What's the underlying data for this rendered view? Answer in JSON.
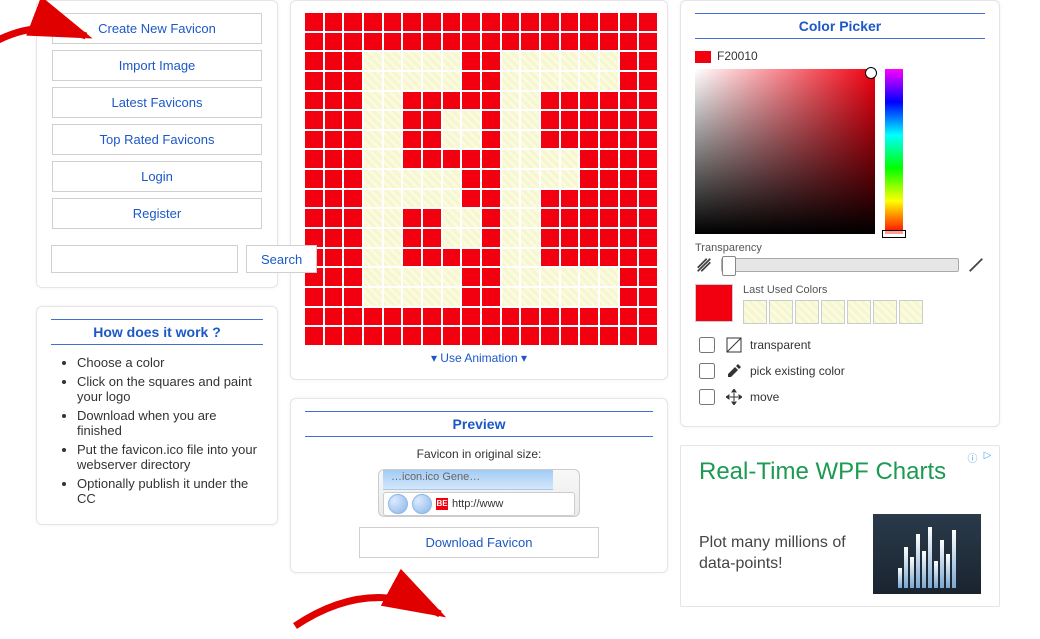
{
  "nav": {
    "create": "Create New Favicon",
    "import": "Import Image",
    "latest": "Latest Favicons",
    "top": "Top Rated Favicons",
    "login": "Login",
    "register": "Register",
    "search_btn": "Search",
    "search_value": ""
  },
  "editor": {
    "use_animation": "▾ Use Animation ▾",
    "rows": 17,
    "cols": 18,
    "off_cells": [
      [
        2,
        3
      ],
      [
        2,
        4
      ],
      [
        2,
        5
      ],
      [
        2,
        6
      ],
      [
        2,
        7
      ],
      [
        2,
        10
      ],
      [
        2,
        11
      ],
      [
        2,
        12
      ],
      [
        2,
        13
      ],
      [
        2,
        14
      ],
      [
        2,
        15
      ],
      [
        3,
        3
      ],
      [
        3,
        4
      ],
      [
        3,
        5
      ],
      [
        3,
        6
      ],
      [
        3,
        7
      ],
      [
        3,
        10
      ],
      [
        3,
        11
      ],
      [
        3,
        12
      ],
      [
        3,
        13
      ],
      [
        3,
        14
      ],
      [
        3,
        15
      ],
      [
        4,
        3
      ],
      [
        4,
        4
      ],
      [
        4,
        10
      ],
      [
        4,
        11
      ],
      [
        5,
        3
      ],
      [
        5,
        4
      ],
      [
        5,
        7
      ],
      [
        5,
        8
      ],
      [
        5,
        10
      ],
      [
        5,
        11
      ],
      [
        6,
        3
      ],
      [
        6,
        4
      ],
      [
        6,
        7
      ],
      [
        6,
        8
      ],
      [
        6,
        10
      ],
      [
        6,
        11
      ],
      [
        7,
        3
      ],
      [
        7,
        4
      ],
      [
        7,
        10
      ],
      [
        7,
        11
      ],
      [
        7,
        12
      ],
      [
        7,
        13
      ],
      [
        8,
        3
      ],
      [
        8,
        4
      ],
      [
        8,
        5
      ],
      [
        8,
        6
      ],
      [
        8,
        7
      ],
      [
        8,
        10
      ],
      [
        8,
        11
      ],
      [
        8,
        12
      ],
      [
        8,
        13
      ],
      [
        9,
        3
      ],
      [
        9,
        4
      ],
      [
        9,
        5
      ],
      [
        9,
        6
      ],
      [
        9,
        7
      ],
      [
        9,
        10
      ],
      [
        9,
        11
      ],
      [
        10,
        3
      ],
      [
        10,
        4
      ],
      [
        10,
        7
      ],
      [
        10,
        8
      ],
      [
        10,
        10
      ],
      [
        10,
        11
      ],
      [
        11,
        3
      ],
      [
        11,
        4
      ],
      [
        11,
        7
      ],
      [
        11,
        8
      ],
      [
        11,
        10
      ],
      [
        11,
        11
      ],
      [
        12,
        3
      ],
      [
        12,
        4
      ],
      [
        12,
        10
      ],
      [
        12,
        11
      ],
      [
        13,
        3
      ],
      [
        13,
        4
      ],
      [
        13,
        5
      ],
      [
        13,
        6
      ],
      [
        13,
        7
      ],
      [
        13,
        10
      ],
      [
        13,
        11
      ],
      [
        13,
        12
      ],
      [
        13,
        13
      ],
      [
        13,
        14
      ],
      [
        13,
        15
      ],
      [
        14,
        3
      ],
      [
        14,
        4
      ],
      [
        14,
        5
      ],
      [
        14,
        6
      ],
      [
        14,
        7
      ],
      [
        14,
        10
      ],
      [
        14,
        11
      ],
      [
        14,
        12
      ],
      [
        14,
        13
      ],
      [
        14,
        14
      ],
      [
        14,
        15
      ]
    ]
  },
  "picker": {
    "title": "Color Picker",
    "current_hex": "F20010",
    "transparency_label": "Transparency",
    "last_used_label": "Last Used Colors",
    "opt_transparent": "transparent",
    "opt_pick": "pick existing color",
    "opt_move": "move"
  },
  "how": {
    "title": "How does it work ?",
    "items": [
      "Choose a color",
      "Click on the squares and paint your logo",
      "Download when you are finished",
      "Put the favicon.ico file into your webserver directory",
      "Optionally publish it under the CC"
    ]
  },
  "preview": {
    "title": "Preview",
    "note": "Favicon in original size:",
    "url_text": "http://www",
    "favicon_text": "BE",
    "download": "Download Favicon"
  },
  "ad": {
    "title": "Real-Time WPF Charts",
    "body": "Plot many millions of data-points!"
  }
}
